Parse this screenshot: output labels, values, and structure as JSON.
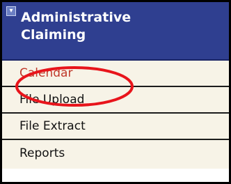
{
  "menu": {
    "title": "Administrative\nClaiming",
    "collapse_icon": "collapse-arrow-icon",
    "items": [
      {
        "label": "Calendar",
        "active": true
      },
      {
        "label": "File Upload",
        "active": false
      },
      {
        "label": "File Extract",
        "active": false
      },
      {
        "label": "Reports",
        "active": false
      }
    ]
  },
  "colors": {
    "header_bg": "#2f3f90",
    "item_bg": "#f7f3e7",
    "active_text": "#c0392b",
    "annotation": "#e8141b"
  }
}
